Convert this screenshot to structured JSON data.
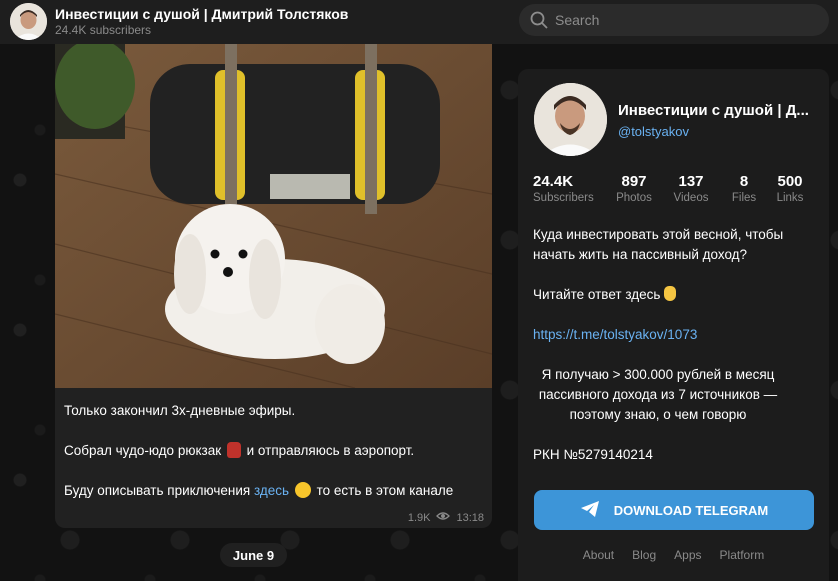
{
  "header": {
    "title": "Инвестиции с душой | Дмитрий Толстяков",
    "subscribers": "24.4K subscribers",
    "search_placeholder": "Search"
  },
  "message": {
    "lines": [
      "Только закончил 3х-дневные эфиры.",
      "Собрал чудо-юдо рюкзак",
      "и отправляюсь в аэропорт.",
      "Буду описывать приключения",
      "здесь",
      "то есть в этом канале"
    ],
    "views": "1.9K",
    "time": "13:18"
  },
  "date_separator": "June 9",
  "panel": {
    "title": "Инвестиции с душой | Д...",
    "handle": "@tolstyakov",
    "stats": [
      {
        "value": "24.4K",
        "label": "Subscribers"
      },
      {
        "value": "897",
        "label": "Photos"
      },
      {
        "value": "137",
        "label": "Videos"
      },
      {
        "value": "8",
        "label": "Files"
      },
      {
        "value": "500",
        "label": "Links"
      }
    ],
    "desc": {
      "p1": "Куда инвестировать этой весной, чтобы начать жить на пассивный доход?",
      "p2": "Читайте ответ здесь",
      "link": "https://t.me/tolstyakov/1073",
      "p3": "Я получаю > 300.000 рублей в месяц пассивного дохода из 7 источников — поэтому знаю, о чем говорю",
      "p4": "РКН №5279140214"
    },
    "download_label": "DOWNLOAD TELEGRAM",
    "footer": [
      "About",
      "Blog",
      "Apps",
      "Platform"
    ]
  },
  "colors": {
    "accent": "#3d95d8",
    "link": "#6ab2f2",
    "panel_bg": "#1c1c1c",
    "bubble_bg": "#212121"
  },
  "icons": {
    "search": "search-icon",
    "views": "eye-icon",
    "telegram": "telegram-plane-icon"
  }
}
